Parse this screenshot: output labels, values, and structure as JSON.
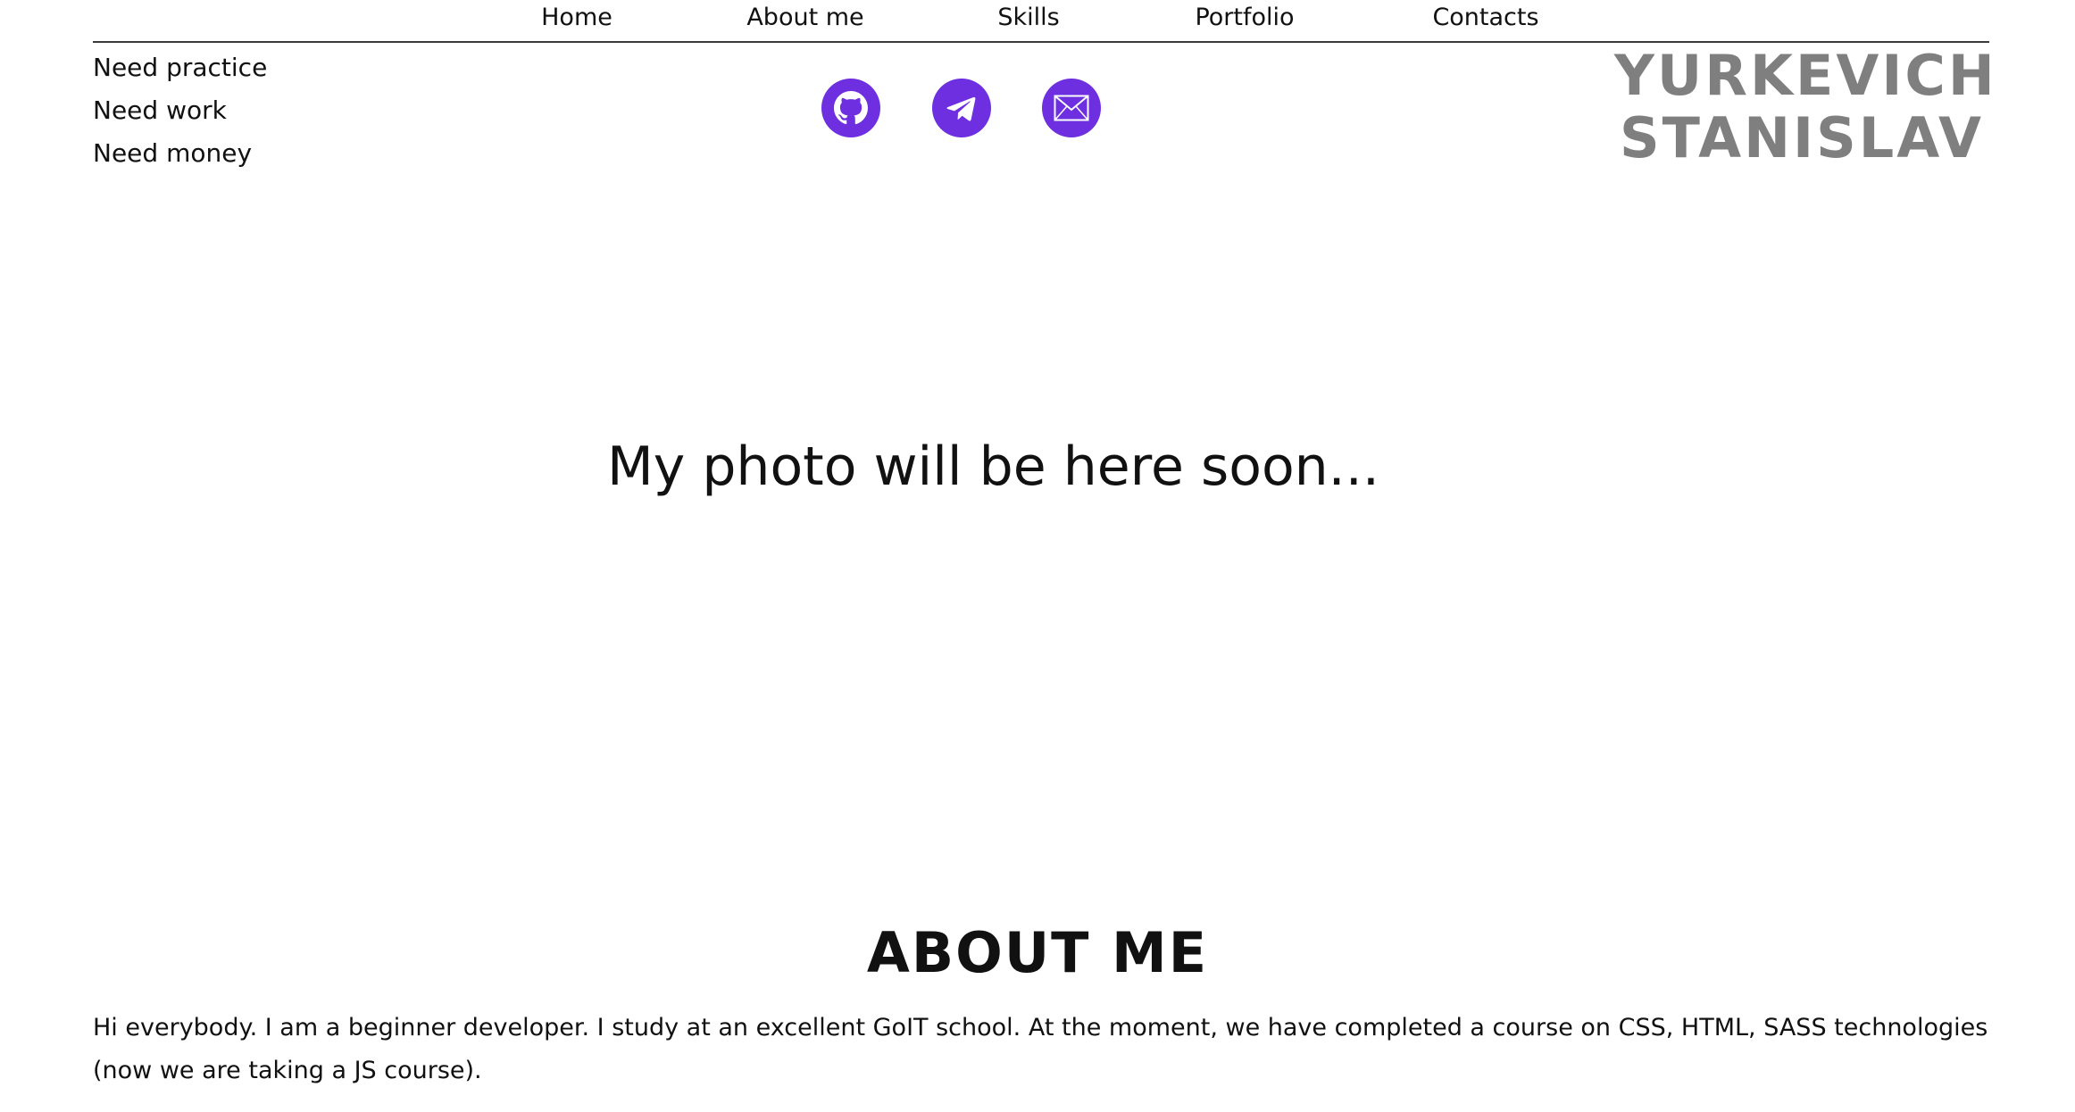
{
  "nav": {
    "items": [
      {
        "label": "Home"
      },
      {
        "label": "About me"
      },
      {
        "label": "Skills"
      },
      {
        "label": "Portfolio"
      },
      {
        "label": "Contacts"
      }
    ]
  },
  "taglines": [
    "Need practice",
    "Need work",
    "Need money"
  ],
  "social": {
    "accent_color": "#6e2fe0",
    "icons": [
      "github-icon",
      "telegram-icon",
      "mail-icon"
    ]
  },
  "name": {
    "first_line": "YURKEVICH",
    "second_line": "STANISLAV",
    "color": "#7f7f7f"
  },
  "photo_placeholder": "My photo will be here soon...",
  "about": {
    "title": "ABOUT ME",
    "text": "Hi everybody. I am a beginner developer. I study at an excellent GoIT school. At the moment, we have completed a course on CSS, HTML, SASS technologies (now we are taking a JS course)."
  }
}
